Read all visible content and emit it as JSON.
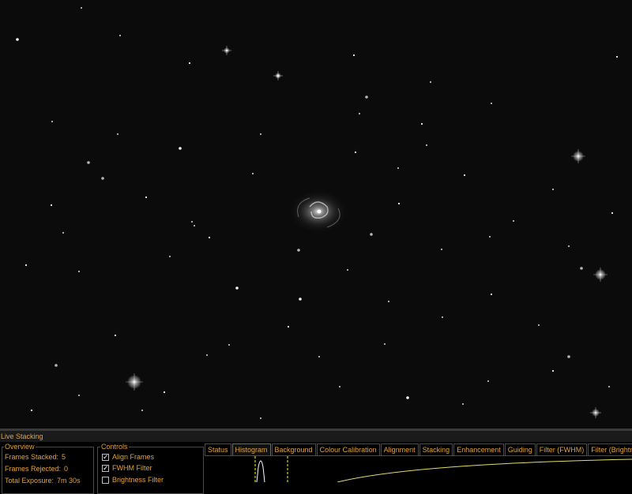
{
  "panel": {
    "title": "Live Stacking"
  },
  "overview": {
    "legend": "Overview",
    "rows": [
      {
        "label": "Frames Stacked:",
        "value": "5"
      },
      {
        "label": "Frames Rejected:",
        "value": "0"
      },
      {
        "label": "Total Exposure:",
        "value": "7m 30s"
      }
    ]
  },
  "controls": {
    "legend": "Controls",
    "items": [
      {
        "label": "Align Frames",
        "checked": true
      },
      {
        "label": "FWHM Filter",
        "checked": true
      },
      {
        "label": "Brightness Filter",
        "checked": false
      }
    ]
  },
  "tabs": [
    {
      "label": "Status",
      "active": false
    },
    {
      "label": "Histogram",
      "active": true
    },
    {
      "label": "Background",
      "active": false
    },
    {
      "label": "Colour Calibration",
      "active": false
    },
    {
      "label": "Alignment",
      "active": false
    },
    {
      "label": "Stacking",
      "active": false
    },
    {
      "label": "Enhancement",
      "active": false
    },
    {
      "label": "Guiding",
      "active": false
    },
    {
      "label": "Filter (FWHM)",
      "active": false
    },
    {
      "label": "Filter (Brightne",
      "active": false
    }
  ],
  "colors": {
    "accent": "#e3a336",
    "background": "#000000",
    "histogram_marker": "#ffff00"
  }
}
